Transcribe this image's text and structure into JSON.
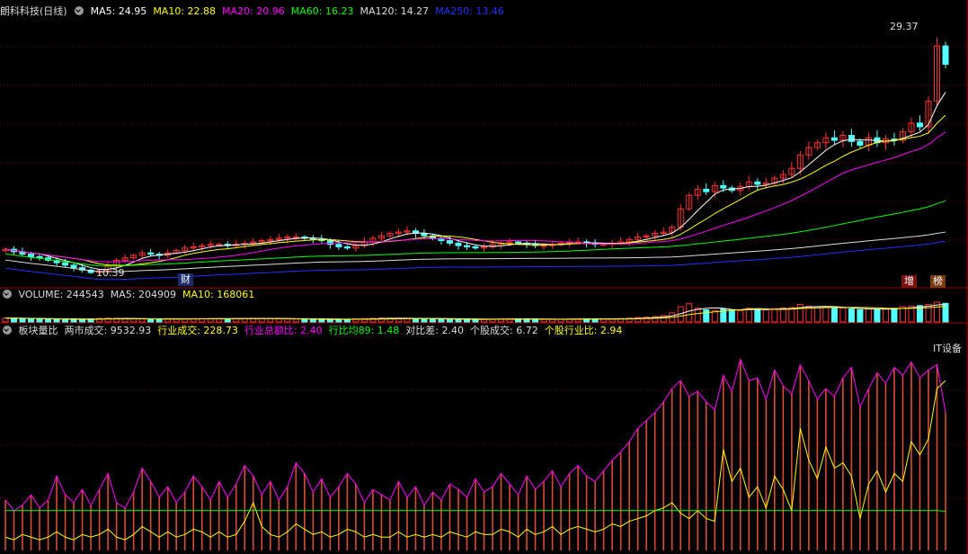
{
  "title": "朗科科技(日线)",
  "ma_legend": [
    {
      "label": "MA5: 24.95",
      "color": "#ffffff"
    },
    {
      "label": "MA10: 22.88",
      "color": "#ffff00"
    },
    {
      "label": "MA20: 20.96",
      "color": "#ff00ff"
    },
    {
      "label": "MA60: 16.23",
      "color": "#00ff00"
    },
    {
      "label": "MA120: 14.27",
      "color": "#dcdcdc"
    },
    {
      "label": "MA250: 13.46",
      "color": "#1e32ff"
    }
  ],
  "volume_legend": [
    {
      "label": "VOLUME: 244543",
      "color": "#dcdcdc"
    },
    {
      "label": "MA5: 204909",
      "color": "#dcdcdc"
    },
    {
      "label": "MA10: 168061",
      "color": "#ffff00"
    }
  ],
  "indicator_legend": [
    {
      "label": "板块量比",
      "color": "#dcdcdc"
    },
    {
      "label": "两市成交: 9532.93",
      "color": "#dcdcdc"
    },
    {
      "label": "行业成交: 228.73",
      "color": "#ffff00"
    },
    {
      "label": "行业总额比: 2.40",
      "color": "#ff00ff"
    },
    {
      "label": "行比均89: 1.48",
      "color": "#00ff00"
    },
    {
      "label": "对比差: 2.40",
      "color": "#dcdcdc"
    },
    {
      "label": "个股成交: 6.72",
      "color": "#dcdcdc"
    },
    {
      "label": "个股行业比: 2.94",
      "color": "#ffff00"
    }
  ],
  "annotations": {
    "high": "29.37",
    "low": "10.39",
    "industry": "IT设备",
    "badge_cai": "财",
    "badge_zeng": "增",
    "badge_bang": "榜"
  },
  "colors": {
    "up": "#ff3232",
    "down": "#54ffff",
    "grid": "#800000"
  },
  "chart_data": {
    "type": "candlestick",
    "price": {
      "range": [
        9.5,
        30.5
      ],
      "close": [
        12.5,
        12.3,
        12.1,
        11.9,
        11.8,
        11.6,
        11.4,
        11.2,
        11.0,
        10.8,
        10.6,
        10.7,
        11.2,
        11.6,
        11.8,
        12.0,
        12.2,
        12.1,
        12.0,
        12.2,
        12.4,
        12.6,
        12.7,
        12.8,
        12.9,
        12.9,
        12.8,
        12.9,
        13.0,
        13.1,
        13.2,
        13.3,
        13.4,
        13.5,
        13.5,
        13.4,
        13.3,
        13.2,
        12.9,
        12.7,
        12.6,
        12.8,
        13.1,
        13.4,
        13.6,
        13.8,
        13.9,
        14.0,
        13.8,
        13.6,
        13.4,
        13.2,
        13.0,
        12.8,
        12.7,
        12.6,
        12.7,
        12.9,
        13.0,
        13.1,
        13.0,
        12.9,
        12.8,
        12.8,
        12.9,
        13.0,
        13.1,
        13.1,
        13.0,
        12.9,
        12.9,
        13.0,
        13.1,
        13.3,
        13.5,
        13.6,
        13.8,
        13.9,
        14.3,
        15.8,
        16.9,
        17.4,
        17.2,
        17.7,
        17.5,
        17.3,
        17.6,
        18.0,
        17.8,
        17.9,
        18.3,
        18.6,
        19.1,
        20.2,
        20.8,
        21.2,
        21.6,
        21.4,
        21.8,
        21.3,
        21.0,
        21.6,
        21.2,
        21.5,
        21.4,
        22.1,
        22.8,
        22.5,
        24.6,
        29.1,
        27.6
      ]
    },
    "volume": {
      "max": 260000,
      "values": [
        52000,
        48000,
        45000,
        42000,
        40000,
        38000,
        36000,
        34000,
        33000,
        35000,
        40000,
        46000,
        50000,
        48000,
        45000,
        42000,
        40000,
        38000,
        36000,
        38000,
        40000,
        42000,
        44000,
        45000,
        44000,
        43000,
        42000,
        44000,
        46000,
        48000,
        46000,
        44000,
        42000,
        40000,
        38000,
        36000,
        34000,
        33000,
        32000,
        34000,
        36000,
        40000,
        44000,
        48000,
        52000,
        50000,
        48000,
        46000,
        44000,
        42000,
        40000,
        38000,
        36000,
        34000,
        33000,
        34000,
        36000,
        38000,
        40000,
        42000,
        40000,
        38000,
        36000,
        35000,
        34000,
        36000,
        38000,
        40000,
        42000,
        40000,
        38000,
        40000,
        44000,
        50000,
        58000,
        64000,
        70000,
        86000,
        120000,
        200000,
        240000,
        180000,
        160000,
        150000,
        170000,
        160000,
        150000,
        180000,
        170000,
        160000,
        175000,
        185000,
        190000,
        230000,
        210000,
        200000,
        190000,
        180000,
        185000,
        170000,
        160000,
        170000,
        165000,
        175000,
        180000,
        200000,
        210000,
        215000,
        230000,
        260000,
        244543
      ],
      "ma5": 204909,
      "ma10": 168061
    },
    "indicator": {
      "range": [
        0,
        8
      ],
      "magenta": [
        1.9,
        1.5,
        1.7,
        2.1,
        1.6,
        1.9,
        2.8,
        2.1,
        1.8,
        2.3,
        1.7,
        2.3,
        2.9,
        1.8,
        1.6,
        2.2,
        3.1,
        2.6,
        2.0,
        2.4,
        1.8,
        2.2,
        2.8,
        2.4,
        1.9,
        2.6,
        2.0,
        2.5,
        3.2,
        2.8,
        2.1,
        2.6,
        1.9,
        2.4,
        3.3,
        2.9,
        2.2,
        2.7,
        2.0,
        2.4,
        2.9,
        2.5,
        1.8,
        2.3,
        2.1,
        1.9,
        2.6,
        2.0,
        2.4,
        1.7,
        2.2,
        1.9,
        2.5,
        2.3,
        2.0,
        2.7,
        2.2,
        2.4,
        2.9,
        2.5,
        2.1,
        2.8,
        2.3,
        2.6,
        3.0,
        2.4,
        2.9,
        3.2,
        2.8,
        2.6,
        3.0,
        3.4,
        3.7,
        4.1,
        4.6,
        4.9,
        5.2,
        5.6,
        6.1,
        6.4,
        5.8,
        6.0,
        5.6,
        5.3,
        6.6,
        6.0,
        7.2,
        6.4,
        6.5,
        5.7,
        6.8,
        6.2,
        5.9,
        7.0,
        6.4,
        5.7,
        6.1,
        5.8,
        6.5,
        6.9,
        5.4,
        6.1,
        6.7,
        6.3,
        6.9,
        6.6,
        7.1,
        6.5,
        6.8,
        7.0,
        5.2
      ],
      "yellow": [
        0.5,
        0.4,
        0.6,
        0.5,
        0.4,
        0.5,
        0.7,
        0.5,
        0.4,
        0.6,
        0.5,
        0.6,
        0.8,
        0.5,
        0.4,
        0.6,
        0.9,
        0.7,
        0.5,
        0.7,
        0.5,
        0.6,
        0.8,
        0.7,
        0.5,
        0.7,
        0.5,
        0.6,
        1.1,
        1.8,
        0.9,
        0.6,
        0.5,
        0.7,
        1.0,
        0.8,
        0.6,
        0.7,
        0.5,
        0.6,
        0.8,
        0.7,
        0.5,
        0.6,
        0.5,
        0.5,
        0.7,
        0.5,
        0.6,
        0.5,
        0.6,
        0.5,
        0.7,
        0.6,
        0.5,
        0.7,
        0.6,
        0.6,
        0.8,
        0.7,
        0.5,
        0.8,
        0.6,
        0.7,
        0.9,
        0.6,
        0.8,
        0.9,
        0.8,
        0.7,
        0.8,
        1.0,
        0.9,
        1.1,
        1.2,
        1.3,
        1.5,
        1.6,
        1.8,
        1.4,
        1.2,
        1.5,
        1.2,
        1.1,
        3.8,
        2.6,
        3.1,
        2.0,
        2.4,
        1.6,
        2.8,
        2.3,
        1.5,
        4.6,
        3.4,
        2.7,
        3.9,
        3.1,
        3.3,
        2.8,
        1.2,
        2.5,
        3.0,
        2.2,
        2.9,
        2.6,
        4.1,
        3.6,
        4.2,
        6.1,
        6.4
      ],
      "green": [
        1.5,
        1.5,
        1.5,
        1.5,
        1.5,
        1.5,
        1.5,
        1.5,
        1.5,
        1.5,
        1.5,
        1.5,
        1.5,
        1.5,
        1.5,
        1.5,
        1.5,
        1.5,
        1.5,
        1.5,
        1.5,
        1.5,
        1.5,
        1.5,
        1.5,
        1.5,
        1.5,
        1.5,
        1.5,
        1.5,
        1.5,
        1.5,
        1.5,
        1.5,
        1.5,
        1.5,
        1.5,
        1.5,
        1.5,
        1.5,
        1.5,
        1.5,
        1.5,
        1.5,
        1.5,
        1.5,
        1.5,
        1.5,
        1.5,
        1.5,
        1.5,
        1.5,
        1.5,
        1.5,
        1.5,
        1.5,
        1.5,
        1.5,
        1.5,
        1.5,
        1.5,
        1.5,
        1.5,
        1.5,
        1.5,
        1.5,
        1.5,
        1.5,
        1.5,
        1.5,
        1.5,
        1.5,
        1.5,
        1.5,
        1.5,
        1.5,
        1.5,
        1.5,
        1.5,
        1.5,
        1.5,
        1.5,
        1.5,
        1.5,
        1.5,
        1.5,
        1.5,
        1.5,
        1.5,
        1.5,
        1.5,
        1.5,
        1.5,
        1.5,
        1.5,
        1.5,
        1.5,
        1.5,
        1.5,
        1.5,
        1.5,
        1.5,
        1.5,
        1.5,
        1.5,
        1.5,
        1.5,
        1.5,
        1.5,
        1.5,
        1.48
      ]
    }
  }
}
